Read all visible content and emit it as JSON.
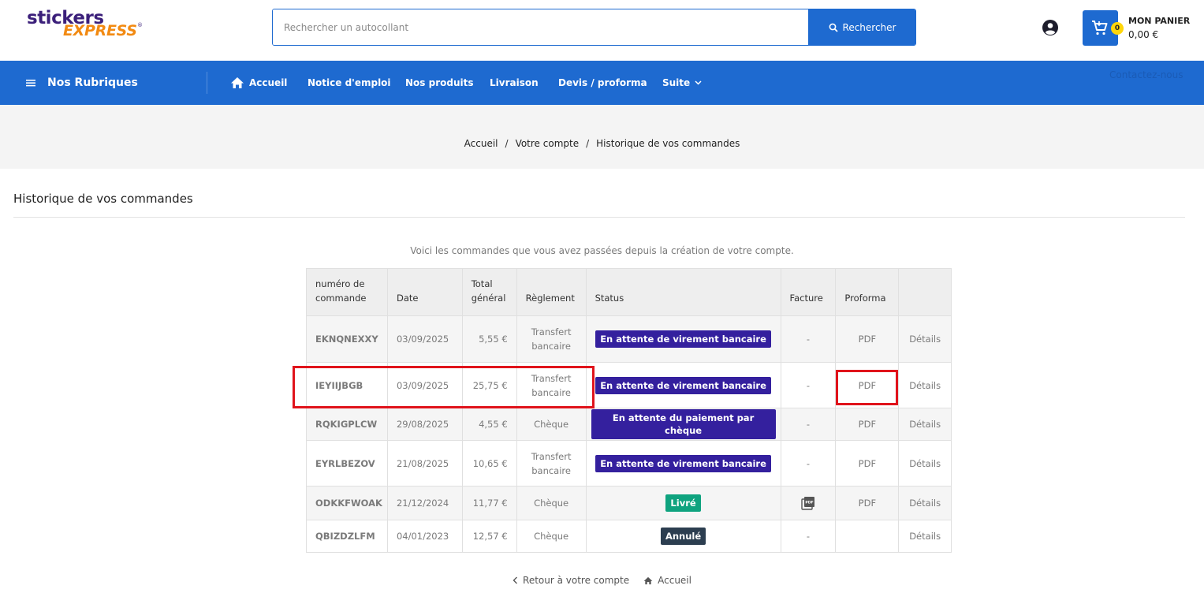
{
  "header": {
    "logo_top": "stickers",
    "logo_bottom": "EXPRESS",
    "logo_reg": "®",
    "search_placeholder": "Rechercher un autocollant",
    "search_button": "Rechercher",
    "cart_title": "MON PANIER",
    "cart_amount": "0,00 €",
    "cart_count": "0"
  },
  "nav": {
    "rubriques": "Nos Rubriques",
    "items": [
      {
        "label": "Accueil"
      },
      {
        "label": "Notice d'emploi"
      },
      {
        "label": "Nos produits"
      },
      {
        "label": "Livraison"
      },
      {
        "label": "Devis / proforma"
      },
      {
        "label": "Suite"
      }
    ],
    "contact": "Contactez-nous"
  },
  "breadcrumb": {
    "items": [
      "Accueil",
      "Votre compte",
      "Historique de vos commandes"
    ],
    "separator": "/"
  },
  "page": {
    "title": "Historique de vos commandes",
    "intro": "Voici les commandes que vous avez passées depuis la création de votre compte."
  },
  "table": {
    "headers": {
      "ref": [
        "numéro de",
        "commande"
      ],
      "date": "Date",
      "total": [
        "Total",
        "général"
      ],
      "payment": "Règlement",
      "status": "Status",
      "invoice": "Facture",
      "proforma": "Proforma"
    },
    "rows": [
      {
        "ref": "EKNQNEXXY",
        "date": "03/09/2025",
        "total": "5,55 €",
        "payment": [
          "Transfert",
          "bancaire"
        ],
        "status": "En attente de virement bancaire",
        "status_color": "#34209e",
        "invoice": "-",
        "proforma": "PDF",
        "details": "Détails"
      },
      {
        "ref": "IEYIIJBGB",
        "date": "03/09/2025",
        "total": "25,75 €",
        "payment": [
          "Transfert",
          "bancaire"
        ],
        "status": "En attente de virement bancaire",
        "status_color": "#34209e",
        "invoice": "-",
        "proforma": "PDF",
        "details": "Détails"
      },
      {
        "ref": "RQKIGPLCW",
        "date": "29/08/2025",
        "total": "4,55 €",
        "payment": [
          "Chèque"
        ],
        "status": "En attente du paiement par chèque",
        "status_color": "#34209e",
        "invoice": "-",
        "proforma": "PDF",
        "details": "Détails"
      },
      {
        "ref": "EYRLBEZOV",
        "date": "21/08/2025",
        "total": "10,65 €",
        "payment": [
          "Transfert",
          "bancaire"
        ],
        "status": "En attente de virement bancaire",
        "status_color": "#34209e",
        "invoice": "-",
        "proforma": "PDF",
        "details": "Détails"
      },
      {
        "ref": "ODKKFWOAK",
        "date": "21/12/2024",
        "total": "11,77 €",
        "payment": [
          "Chèque"
        ],
        "status": "Livré",
        "status_color": "#0fa37f",
        "invoice": "pdf-icon",
        "proforma": "PDF",
        "details": "Détails"
      },
      {
        "ref": "QBIZDZLFM",
        "date": "04/01/2023",
        "total": "12,57 €",
        "payment": [
          "Chèque"
        ],
        "status": "Annulé",
        "status_color": "#2c3e50",
        "invoice": "-",
        "proforma": "",
        "details": "Détails"
      }
    ]
  },
  "footer": {
    "back": "Retour à votre compte",
    "home": "Accueil"
  },
  "colors": {
    "brand_blue": "#1e6ad0",
    "highlight_red": "#e0131b",
    "badge_purple": "#34209e",
    "badge_green": "#0fa37f",
    "badge_dark": "#2c3e50"
  }
}
